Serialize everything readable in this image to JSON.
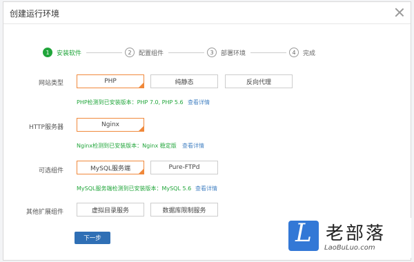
{
  "dialog": {
    "title": "创建运行环境"
  },
  "steps": [
    {
      "num": "1",
      "label": "安装软件"
    },
    {
      "num": "2",
      "label": "配置组件"
    },
    {
      "num": "3",
      "label": "部署环境"
    },
    {
      "num": "4",
      "label": "完成"
    }
  ],
  "site_type": {
    "label": "网站类型",
    "options": [
      "PHP",
      "纯静态",
      "反向代理"
    ],
    "selected": "PHP",
    "hint": "PHP检测到已安装版本：PHP 7.0, PHP 5.6",
    "link": "查看详情"
  },
  "http_server": {
    "label": "HTTP服务器",
    "options": [
      "Nginx"
    ],
    "selected": "Nginx",
    "hint": "Nginx检测到已安装版本：Nginx 稳定版",
    "link": "查看详情"
  },
  "optional": {
    "label": "可选组件",
    "options": [
      "MySQL服务端",
      "Pure-FTPd"
    ],
    "selected": "MySQL服务端",
    "hint": "MySQL服务端检测到已安装版本：MySQL 5.6",
    "link": "查看详情"
  },
  "extensions": {
    "label": "其他扩展组件",
    "options": [
      "虚拟目录服务",
      "数据库限制服务"
    ]
  },
  "next_button": "下一步",
  "watermark": {
    "logo_glyph": "L",
    "name": "老部落",
    "url": "LaoBuLuo.com"
  },
  "colors": {
    "accent_green": "#20a53a",
    "selected_border": "#f0883a",
    "link_blue": "#4a86c5",
    "button_blue": "#2f6fb5",
    "watermark_blue": "#3378d6"
  }
}
